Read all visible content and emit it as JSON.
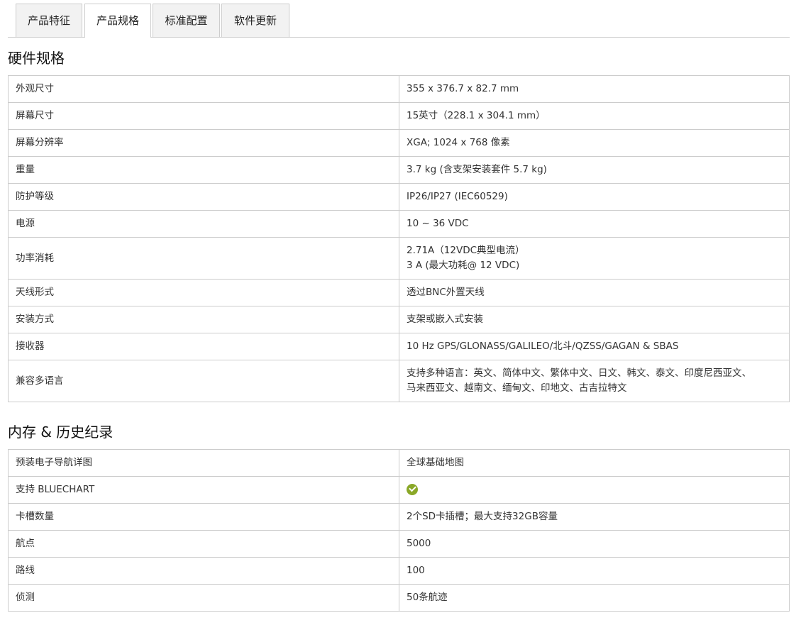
{
  "tabs": [
    {
      "label": "产品特征"
    },
    {
      "label": "产品规格"
    },
    {
      "label": "标准配置"
    },
    {
      "label": "软件更新"
    }
  ],
  "hardware": {
    "title": "硬件规格",
    "rows": [
      {
        "label": "外观尺寸",
        "value": "355 x 376.7 x 82.7 mm"
      },
      {
        "label": "屏幕尺寸",
        "value": "15英寸（228.1 x 304.1 mm）"
      },
      {
        "label": "屏幕分辨率",
        "value": "XGA; 1024 x 768 像素"
      },
      {
        "label": "重量",
        "value": "3.7 kg (含支架安装套件 5.7 kg)"
      },
      {
        "label": "防护等级",
        "value": "IP26/IP27 (IEC60529)"
      },
      {
        "label": "电源",
        "value": "10 ~ 36 VDC"
      },
      {
        "label": "功率消耗",
        "value": "2.71A（12VDC典型电流）",
        "value2": "3 A (最大功耗@ 12 VDC)"
      },
      {
        "label": "天线形式",
        "value": "透过BNC外置天线"
      },
      {
        "label": "安装方式",
        "value": "支架或嵌入式安装"
      },
      {
        "label": "接收器",
        "value": "10 Hz GPS/GLONASS/GALILEO/北斗/QZSS/GAGAN & SBAS"
      },
      {
        "label": "兼容多语言",
        "value": "支持多种语言：英文、简体中文、繁体中文、日文、韩文、泰文、印度尼西亚文、",
        "value2": "马来西亚文、越南文、缅甸文、印地文、古吉拉特文"
      }
    ]
  },
  "memory": {
    "title": "内存 & 历史纪录",
    "rows": [
      {
        "label": "预装电子导航详图",
        "value": "全球基础地图"
      },
      {
        "label": "支持 BLUECHART",
        "value": "",
        "icon": "check-circle-icon"
      },
      {
        "label": "卡槽数量",
        "value": "2个SD卡插槽；最大支持32GB容量"
      },
      {
        "label": "航点",
        "value": "5000"
      },
      {
        "label": "路线",
        "value": "100"
      },
      {
        "label": "侦测",
        "value": "50条航迹"
      }
    ]
  },
  "colors": {
    "check": "#8aa828",
    "border": "#cccccc",
    "tab_bg": "#f2f2f2"
  }
}
